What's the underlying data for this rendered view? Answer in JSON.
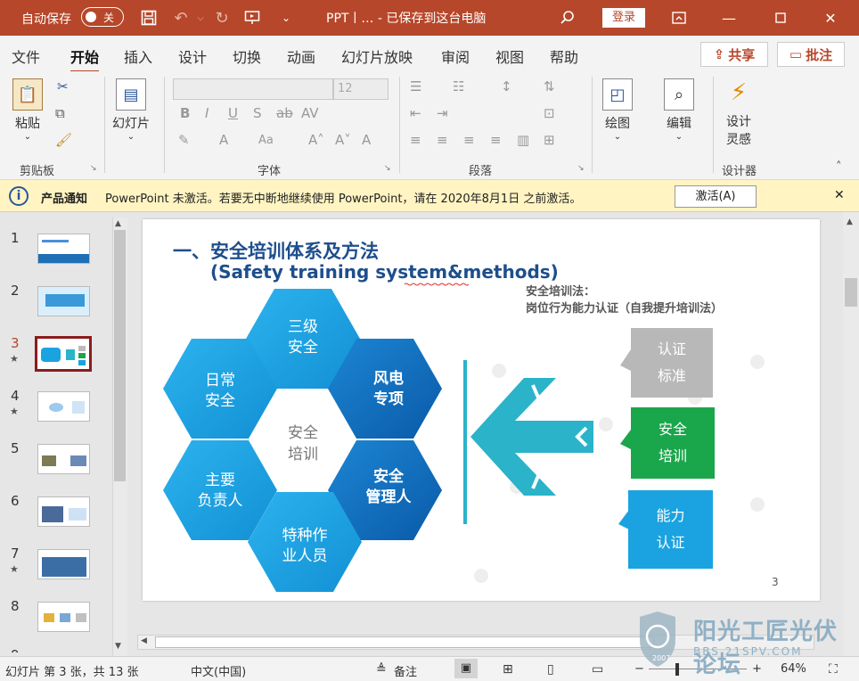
{
  "titlebar": {
    "autosave_label": "自动保存",
    "autosave_state": "关",
    "doc_title": "PPT丨… - 已保存到这台电脑",
    "login": "登录"
  },
  "menu": {
    "items": [
      "文件",
      "开始",
      "插入",
      "设计",
      "切换",
      "动画",
      "幻灯片放映",
      "审阅",
      "视图",
      "帮助"
    ],
    "active": "开始",
    "share": "共享",
    "comments": "批注"
  },
  "ribbon": {
    "paste": "粘贴",
    "clipboard": "剪贴板",
    "slides": "幻灯片",
    "font_group": "字体",
    "font_size": "12",
    "paragraph": "段落",
    "drawing": "绘图",
    "editing": "编辑",
    "designer_btn_1": "设计",
    "designer_btn_2": "灵感",
    "designer": "设计器"
  },
  "notice": {
    "title": "产品通知",
    "message": "PowerPoint 未激活。若要无中断地继续使用 PowerPoint，请在 2020年8月1日 之前激活。",
    "button": "激活(A)"
  },
  "thumbnails": [
    {
      "num": "1",
      "star": ""
    },
    {
      "num": "2",
      "star": ""
    },
    {
      "num": "3",
      "star": "★"
    },
    {
      "num": "4",
      "star": "★"
    },
    {
      "num": "5",
      "star": ""
    },
    {
      "num": "6",
      "star": ""
    },
    {
      "num": "7",
      "star": "★"
    },
    {
      "num": "8",
      "star": ""
    },
    {
      "num": "9",
      "star": ""
    }
  ],
  "slide": {
    "title": "一、安全培训体系及方法",
    "subtitle": "(Safety training system&methods)",
    "note_line1": "安全培训法：",
    "note_line2": "岗位行为能力认证（自我提升培训法）",
    "center": [
      "安全",
      "培训"
    ],
    "hexes": {
      "top": [
        "三级",
        "安全"
      ],
      "top_right": [
        "风电",
        "专项"
      ],
      "bottom_right": [
        "安全",
        "管理人"
      ],
      "bottom": [
        "特种作",
        "业人员"
      ],
      "bottom_left": [
        "主要",
        "负责人"
      ],
      "top_left": [
        "日常",
        "安全"
      ]
    },
    "boxes": {
      "cert": [
        "认证",
        "标准"
      ],
      "train": [
        "安全",
        "培训"
      ],
      "ability": [
        "能力",
        "认证"
      ]
    },
    "page_number": "3",
    "colors": {
      "hex_light": "#1aa3e0",
      "hex_dark": "#0b6bbf",
      "arrow": "#2ab3c9",
      "gray_box": "#b8b8b8",
      "green_box": "#1aa64b",
      "blue_box": "#1aa3e0"
    }
  },
  "statusbar": {
    "slide_info": "幻灯片 第 3 张，共 13 张",
    "language": "中文(中国)",
    "notes": "备注",
    "zoom": "64%"
  },
  "watermark": {
    "name": "阳光工匠光伏论坛",
    "url": "BBS.21SPV.COM",
    "year": "2007"
  }
}
